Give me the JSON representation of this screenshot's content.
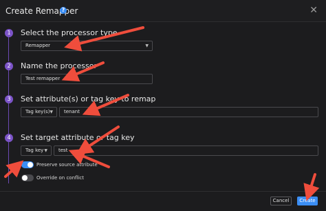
{
  "modal": {
    "title": "Create Remapper",
    "help_icon": "question-circle-icon",
    "close_icon": "close-icon"
  },
  "steps": [
    {
      "number": "1",
      "title": "Select the processor type"
    },
    {
      "number": "2",
      "title": "Name the processor"
    },
    {
      "number": "3",
      "title": "Set attribute(s) or tag key to remap"
    },
    {
      "number": "4",
      "title": "Set target attribute or tag key"
    }
  ],
  "processor_type": {
    "value": "Remapper"
  },
  "processor_name": {
    "value": "Test remapper"
  },
  "source": {
    "type_value": "Tag key(s)",
    "attribute_value": "tenant"
  },
  "target": {
    "type_value": "Tag key",
    "attribute_value": "test"
  },
  "toggles": {
    "preserve_source": {
      "label": "Preserve source attribute",
      "on": true
    },
    "override_on_conflict": {
      "label": "Override on conflict",
      "on": false
    }
  },
  "footer": {
    "cancel_label": "Cancel",
    "create_label": "Create"
  },
  "colors": {
    "accent": "#3b8ef5",
    "step": "#7c54c8",
    "annotation_arrow": "#ef4d3c",
    "background": "#1c1c1e"
  }
}
